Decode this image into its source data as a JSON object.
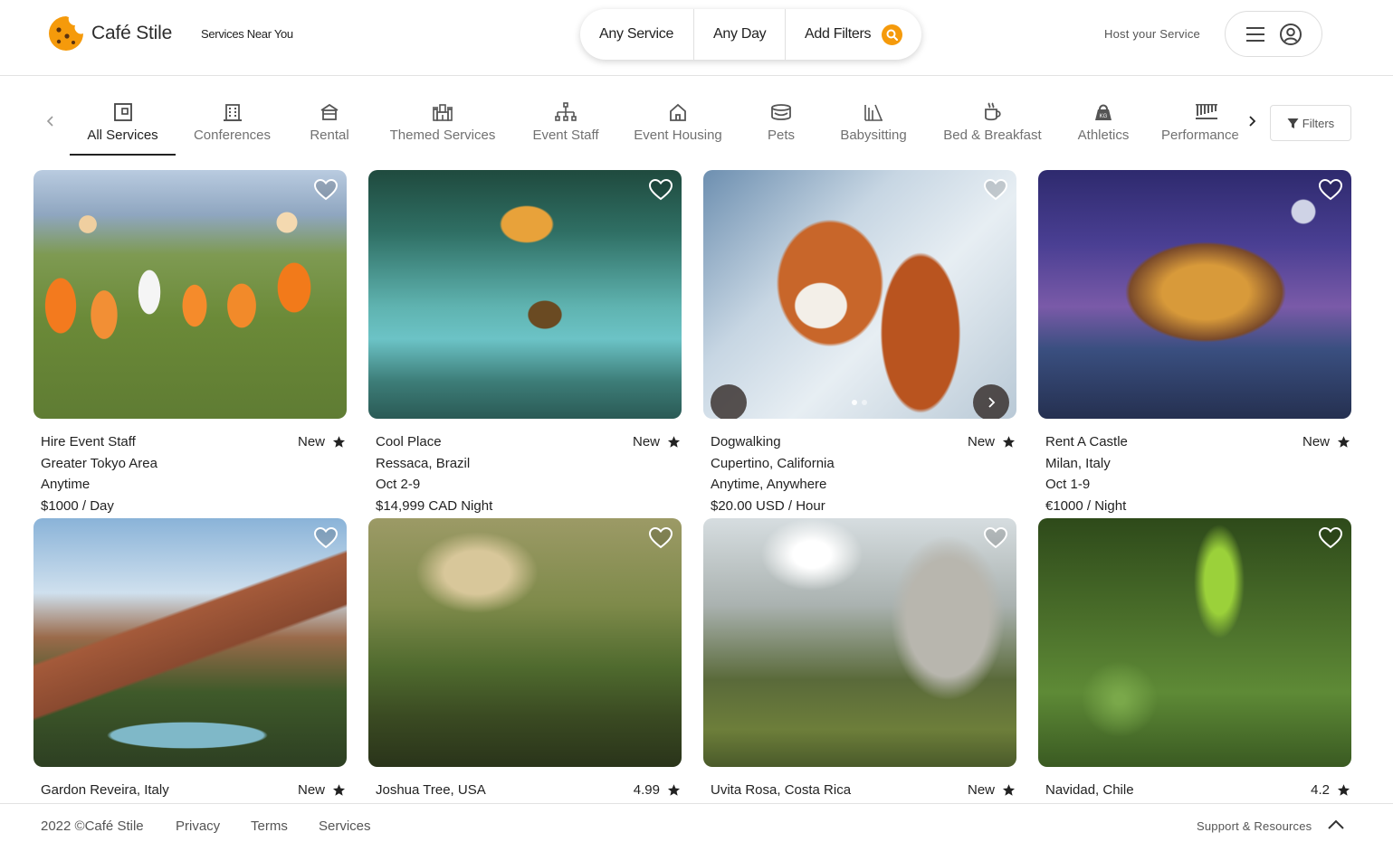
{
  "header": {
    "brand": "Café Stile",
    "tagline": "Services Near You",
    "search": {
      "service": "Any Service",
      "day": "Any Day",
      "filters": "Add Filters"
    },
    "host_link": "Host your Service"
  },
  "categories": [
    {
      "label": "All Services",
      "icon": "all-services-icon",
      "active": true
    },
    {
      "label": "Conferences",
      "icon": "building-icon"
    },
    {
      "label": "Rental",
      "icon": "tent-icon"
    },
    {
      "label": "Themed Services",
      "icon": "castle-icon"
    },
    {
      "label": "Event Staff",
      "icon": "org-chart-icon"
    },
    {
      "label": "Event Housing",
      "icon": "house-icon"
    },
    {
      "label": "Pets",
      "icon": "pet-bed-icon"
    },
    {
      "label": "Babysitting",
      "icon": "stroller-icon"
    },
    {
      "label": "Bed & Breakfast",
      "icon": "coffee-icon"
    },
    {
      "label": "Athletics",
      "icon": "kettlebell-icon"
    },
    {
      "label": "Performance",
      "icon": "xylophone-icon"
    }
  ],
  "filters_button": "Filters",
  "listings": [
    {
      "title": "Hire Event Staff",
      "location": "Greater Tokyo Area",
      "dates": "Anytime",
      "price": "$1000 / Day",
      "rating": "New"
    },
    {
      "title": "Cool Place",
      "location": "Ressaca, Brazil",
      "dates": "Oct 2-9",
      "price": "$14,999 CAD Night",
      "rating": "New"
    },
    {
      "title": "Dogwalking",
      "location": "Cupertino, California",
      "dates": "Anytime, Anywhere",
      "price": "$20.00 USD / Hour",
      "rating": "New"
    },
    {
      "title": "Rent A Castle",
      "location": "Milan, Italy",
      "dates": "Oct 1-9",
      "price": "€1000 / Night",
      "rating": "New"
    },
    {
      "title": "Gardon Reveira, Italy",
      "rating": "New"
    },
    {
      "title": "Joshua Tree, USA",
      "rating": "4.99"
    },
    {
      "title": "Uvita Rosa, Costa Rica",
      "rating": "New"
    },
    {
      "title": "Navidad, Chile",
      "rating": "4.2"
    }
  ],
  "footer": {
    "copyright": "2022 ©Café Stile",
    "links": [
      "Privacy",
      "Terms",
      "Services"
    ],
    "support": "Support & Resources"
  },
  "colors": {
    "accent": "#f59a0b",
    "text": "#222222",
    "muted": "#717171"
  }
}
